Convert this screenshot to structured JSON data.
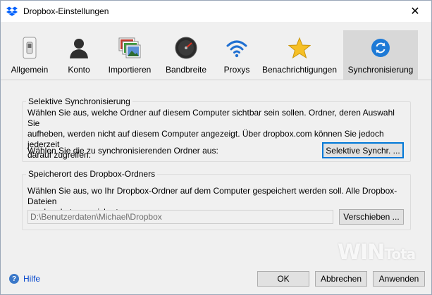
{
  "window": {
    "title": "Dropbox-Einstellungen",
    "close_glyph": "✕"
  },
  "tabs": [
    {
      "label": "Allgemein",
      "icon": "switch-icon"
    },
    {
      "label": "Konto",
      "icon": "user-icon"
    },
    {
      "label": "Importieren",
      "icon": "photos-icon"
    },
    {
      "label": "Bandbreite",
      "icon": "gauge-icon"
    },
    {
      "label": "Proxys",
      "icon": "wifi-icon"
    },
    {
      "label": "Benachrichtigungen",
      "icon": "star-icon"
    },
    {
      "label": "Synchronisierung",
      "icon": "sync-icon",
      "active": true
    }
  ],
  "selective_sync": {
    "title": "Selektive Synchronisierung",
    "description_line1": "Wählen Sie aus, welche Ordner auf diesem Computer sichtbar sein sollen. Ordner, deren Auswahl Sie",
    "description_line2": "aufheben, werden nicht auf diesem Computer angezeigt. Über dropbox.com können Sie jedoch jederzeit",
    "description_line3": "darauf zugreifen.",
    "prompt": "Wählen Sie die zu synchronisierenden Ordner aus:",
    "button_label": "Selektive Synchr. ..."
  },
  "location": {
    "title": "Speicherort des Dropbox-Ordners",
    "description_line1": "Wählen Sie aus, wo Ihr Dropbox-Ordner auf dem Computer gespeichert werden soll. Alle Dropbox-Dateien",
    "description_line2": "werden dort gespeichert.",
    "path_value": "D:\\Benutzerdaten\\Michael\\Dropbox",
    "move_button_label": "Verschieben ..."
  },
  "footer": {
    "help_label": "Hilfe",
    "help_glyph": "?",
    "ok_label": "OK",
    "cancel_label": "Abbrechen",
    "apply_label": "Anwenden"
  },
  "watermark": {
    "main": "WIN",
    "suffix": "Tota"
  },
  "colors": {
    "accent": "#0078d7",
    "dropbox_blue": "#0061fe",
    "active_tab": "#d8d8d8"
  }
}
